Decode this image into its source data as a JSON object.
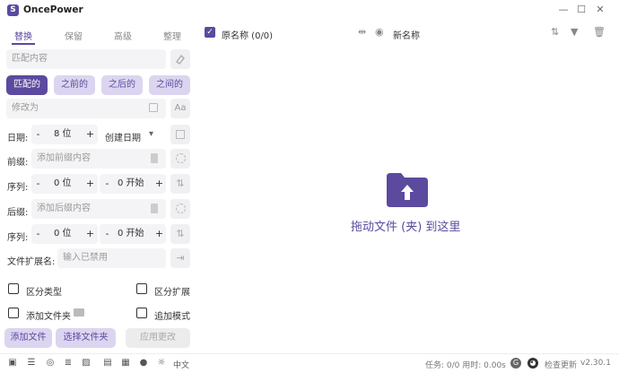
{
  "app": {
    "title": "OncePower",
    "icon_letter": "S"
  },
  "window": {
    "minimize": "—",
    "maximize": "☐",
    "close": "✕"
  },
  "tabs": [
    "替换",
    "保留",
    "高级",
    "整理"
  ],
  "match": {
    "placeholder": "匹配内容"
  },
  "match_modes": [
    "匹配的",
    "之前的",
    "之后的",
    "之间的"
  ],
  "replace": {
    "placeholder": "修改为",
    "case_label": "Aa"
  },
  "date": {
    "label": "日期:",
    "minus": "-",
    "value": "8 位",
    "plus": "+",
    "type": "创建日期",
    "arrow": "▾"
  },
  "prefix": {
    "label": "前缀:",
    "placeholder": "添加前缀内容"
  },
  "seq1": {
    "label": "序列:",
    "minus": "-",
    "digits": "0 位",
    "plus": "+",
    "minus2": "-",
    "start": "0 开始",
    "plus2": "+"
  },
  "suffix": {
    "label": "后缀:",
    "placeholder": "添加后缀内容"
  },
  "seq2": {
    "label": "序列:",
    "minus": "-",
    "digits": "0 位",
    "plus": "+",
    "minus2": "-",
    "start": "0 开始",
    "plus2": "+"
  },
  "ext": {
    "label": "文件扩展名:",
    "placeholder": "输入已禁用"
  },
  "options": {
    "distinguish_type": "区分类型",
    "distinguish_ext": "区分扩展",
    "add_folder": "添加文件夹",
    "append_mode": "追加模式"
  },
  "actions": {
    "add_file": "添加文件",
    "select_folder": "选择文件夹",
    "apply": "应用更改"
  },
  "header": {
    "original": "原名称 (0/0)",
    "new_name": "新名称"
  },
  "drop": {
    "text": "拖动文件 (夹) 到这里"
  },
  "status": {
    "lang": "中文",
    "task": "任务: 0/0 用时: 0.00s",
    "check_update": "检查更新",
    "version": "v2.30.1"
  },
  "colors": {
    "accent": "#5b4a9e",
    "accent_light": "#dcd5f0"
  }
}
